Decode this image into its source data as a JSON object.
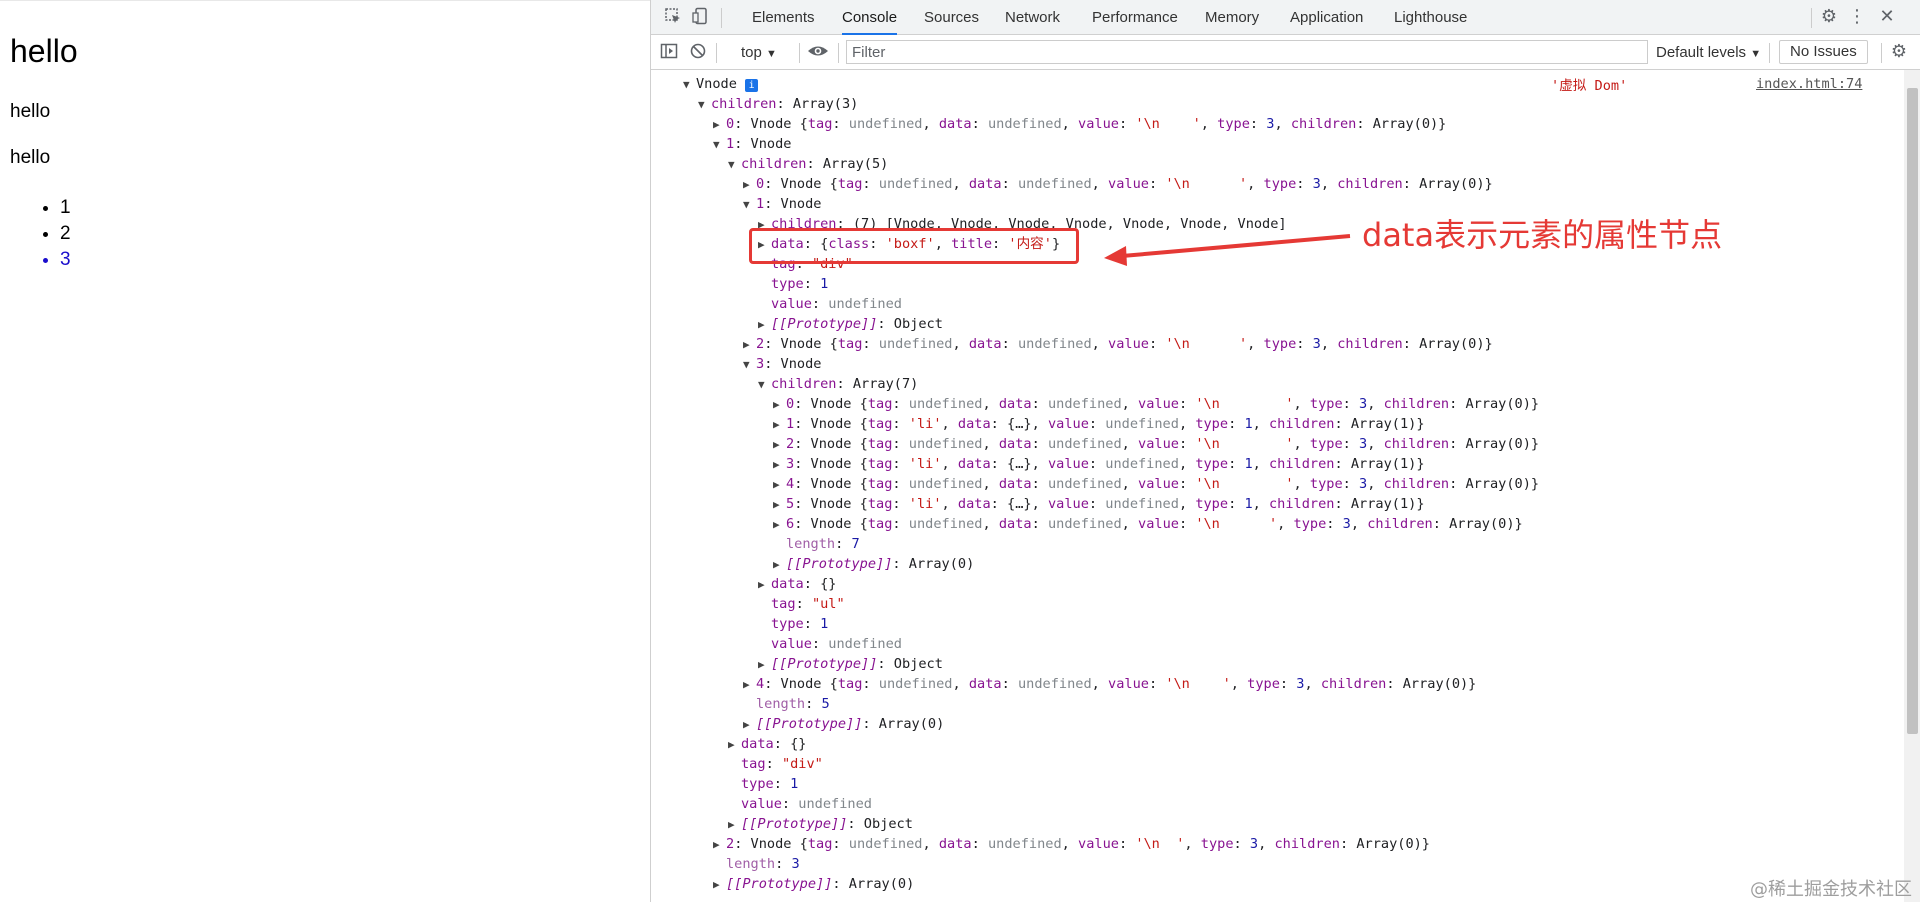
{
  "page": {
    "heading": "hello",
    "para1": "hello",
    "para2": "hello",
    "list": [
      "1",
      "2",
      "3"
    ]
  },
  "devtools": {
    "tabs": [
      "Elements",
      "Console",
      "Sources",
      "Network",
      "Performance",
      "Memory",
      "Application",
      "Lighthouse"
    ],
    "active_tab": "Console",
    "context": "top",
    "filter_placeholder": "Filter",
    "levels": "Default levels",
    "issues": "No Issues",
    "icons": [
      "inspect-icon",
      "device-icon",
      "settings-icon",
      "more-icon",
      "close-icon",
      "sidebar-icon",
      "clear-icon",
      "eye-icon"
    ]
  },
  "console": {
    "message_label": "'虚拟 Dom'",
    "source_link": "index.html:74",
    "lines": [
      {
        "i": 0,
        "t": "d",
        "h": "<span>Vnode</span> <span style=\"display:inline-block;width:13px;height:13px;background:#1a73e8;color:#fff;font-size:10px;line-height:13px;text-align:center;border-radius:2px;\">i</span>"
      },
      {
        "i": 1,
        "t": "d",
        "h": "<span class=\"k\">children</span>: Array(3)"
      },
      {
        "i": 2,
        "t": "r",
        "h": "<span class=\"k\">0</span>: Vnode {<span class=\"k\">tag</span>: <span class=\"u\">undefined</span>, <span class=\"k\">data</span>: <span class=\"u\">undefined</span>, <span class=\"k\">value</span>: <span class=\"s\">'\\n    '</span>, <span class=\"k\">type</span>: <span class=\"n\">3</span>, <span class=\"k\">children</span>: Array(0)}"
      },
      {
        "i": 2,
        "t": "d",
        "h": "<span class=\"k\">1</span>: Vnode"
      },
      {
        "i": 3,
        "t": "d",
        "h": "<span class=\"k\">children</span>: Array(5)"
      },
      {
        "i": 4,
        "t": "r",
        "h": "<span class=\"k\">0</span>: Vnode {<span class=\"k\">tag</span>: <span class=\"u\">undefined</span>, <span class=\"k\">data</span>: <span class=\"u\">undefined</span>, <span class=\"k\">value</span>: <span class=\"s\">'\\n      '</span>, <span class=\"k\">type</span>: <span class=\"n\">3</span>, <span class=\"k\">children</span>: Array(0)}"
      },
      {
        "i": 4,
        "t": "d",
        "h": "<span class=\"k\">1</span>: Vnode"
      },
      {
        "i": 5,
        "t": "r",
        "h": "<span class=\"k\">children</span>: (7) [Vnode, Vnode, Vnode, Vnode, Vnode, Vnode, Vnode]"
      },
      {
        "i": 5,
        "t": "r",
        "h": "<span class=\"k\">data</span>: {<span class=\"k\">class</span>: <span class=\"s\">'boxf'</span>, <span class=\"k\">title</span>: <span class=\"s\">'内容'</span>}"
      },
      {
        "i": 5,
        "t": "n",
        "h": "<span class=\"k\">tag</span>: <span class=\"s\">\"div\"</span>"
      },
      {
        "i": 5,
        "t": "n",
        "h": "<span class=\"k\">type</span>: <span class=\"n\">1</span>"
      },
      {
        "i": 5,
        "t": "n",
        "h": "<span class=\"k\">value</span>: <span class=\"u\">undefined</span>"
      },
      {
        "i": 5,
        "t": "r",
        "h": "<span class=\"k it\">[[Prototype]]</span>: Object"
      },
      {
        "i": 4,
        "t": "r",
        "h": "<span class=\"k\">2</span>: Vnode {<span class=\"k\">tag</span>: <span class=\"u\">undefined</span>, <span class=\"k\">data</span>: <span class=\"u\">undefined</span>, <span class=\"k\">value</span>: <span class=\"s\">'\\n      '</span>, <span class=\"k\">type</span>: <span class=\"n\">3</span>, <span class=\"k\">children</span>: Array(0)}"
      },
      {
        "i": 4,
        "t": "d",
        "h": "<span class=\"k\">3</span>: Vnode"
      },
      {
        "i": 5,
        "t": "d",
        "h": "<span class=\"k\">children</span>: Array(7)"
      },
      {
        "i": 6,
        "t": "r",
        "h": "<span class=\"k\">0</span>: Vnode {<span class=\"k\">tag</span>: <span class=\"u\">undefined</span>, <span class=\"k\">data</span>: <span class=\"u\">undefined</span>, <span class=\"k\">value</span>: <span class=\"s\">'\\n        '</span>, <span class=\"k\">type</span>: <span class=\"n\">3</span>, <span class=\"k\">children</span>: Array(0)}"
      },
      {
        "i": 6,
        "t": "r",
        "h": "<span class=\"k\">1</span>: Vnode {<span class=\"k\">tag</span>: <span class=\"s\">'li'</span>, <span class=\"k\">data</span>: {…}, <span class=\"k\">value</span>: <span class=\"u\">undefined</span>, <span class=\"k\">type</span>: <span class=\"n\">1</span>, <span class=\"k\">children</span>: Array(1)}"
      },
      {
        "i": 6,
        "t": "r",
        "h": "<span class=\"k\">2</span>: Vnode {<span class=\"k\">tag</span>: <span class=\"u\">undefined</span>, <span class=\"k\">data</span>: <span class=\"u\">undefined</span>, <span class=\"k\">value</span>: <span class=\"s\">'\\n        '</span>, <span class=\"k\">type</span>: <span class=\"n\">3</span>, <span class=\"k\">children</span>: Array(0)}"
      },
      {
        "i": 6,
        "t": "r",
        "h": "<span class=\"k\">3</span>: Vnode {<span class=\"k\">tag</span>: <span class=\"s\">'li'</span>, <span class=\"k\">data</span>: {…}, <span class=\"k\">value</span>: <span class=\"u\">undefined</span>, <span class=\"k\">type</span>: <span class=\"n\">1</span>, <span class=\"k\">children</span>: Array(1)}"
      },
      {
        "i": 6,
        "t": "r",
        "h": "<span class=\"k\">4</span>: Vnode {<span class=\"k\">tag</span>: <span class=\"u\">undefined</span>, <span class=\"k\">data</span>: <span class=\"u\">undefined</span>, <span class=\"k\">value</span>: <span class=\"s\">'\\n        '</span>, <span class=\"k\">type</span>: <span class=\"n\">3</span>, <span class=\"k\">children</span>: Array(0)}"
      },
      {
        "i": 6,
        "t": "r",
        "h": "<span class=\"k\">5</span>: Vnode {<span class=\"k\">tag</span>: <span class=\"s\">'li'</span>, <span class=\"k\">data</span>: {…}, <span class=\"k\">value</span>: <span class=\"u\">undefined</span>, <span class=\"k\">type</span>: <span class=\"n\">1</span>, <span class=\"k\">children</span>: Array(1)}"
      },
      {
        "i": 6,
        "t": "r",
        "h": "<span class=\"k\">6</span>: Vnode {<span class=\"k\">tag</span>: <span class=\"u\">undefined</span>, <span class=\"k\">data</span>: <span class=\"u\">undefined</span>, <span class=\"k\">value</span>: <span class=\"s\">'\\n      '</span>, <span class=\"k\">type</span>: <span class=\"n\">3</span>, <span class=\"k\">children</span>: Array(0)}"
      },
      {
        "i": 6,
        "t": "n",
        "h": "<span class=\"kd\">length</span>: <span class=\"n\">7</span>"
      },
      {
        "i": 6,
        "t": "r",
        "h": "<span class=\"k it\">[[Prototype]]</span>: Array(0)"
      },
      {
        "i": 5,
        "t": "r",
        "h": "<span class=\"k\">data</span>: {}"
      },
      {
        "i": 5,
        "t": "n",
        "h": "<span class=\"k\">tag</span>: <span class=\"s\">\"ul\"</span>"
      },
      {
        "i": 5,
        "t": "n",
        "h": "<span class=\"k\">type</span>: <span class=\"n\">1</span>"
      },
      {
        "i": 5,
        "t": "n",
        "h": "<span class=\"k\">value</span>: <span class=\"u\">undefined</span>"
      },
      {
        "i": 5,
        "t": "r",
        "h": "<span class=\"k it\">[[Prototype]]</span>: Object"
      },
      {
        "i": 4,
        "t": "r",
        "h": "<span class=\"k\">4</span>: Vnode {<span class=\"k\">tag</span>: <span class=\"u\">undefined</span>, <span class=\"k\">data</span>: <span class=\"u\">undefined</span>, <span class=\"k\">value</span>: <span class=\"s\">'\\n    '</span>, <span class=\"k\">type</span>: <span class=\"n\">3</span>, <span class=\"k\">children</span>: Array(0)}"
      },
      {
        "i": 4,
        "t": "n",
        "h": "<span class=\"kd\">length</span>: <span class=\"n\">5</span>"
      },
      {
        "i": 4,
        "t": "r",
        "h": "<span class=\"k it\">[[Prototype]]</span>: Array(0)"
      },
      {
        "i": 3,
        "t": "r",
        "h": "<span class=\"k\">data</span>: {}"
      },
      {
        "i": 3,
        "t": "n",
        "h": "<span class=\"k\">tag</span>: <span class=\"s\">\"div\"</span>"
      },
      {
        "i": 3,
        "t": "n",
        "h": "<span class=\"k\">type</span>: <span class=\"n\">1</span>"
      },
      {
        "i": 3,
        "t": "n",
        "h": "<span class=\"k\">value</span>: <span class=\"u\">undefined</span>"
      },
      {
        "i": 3,
        "t": "r",
        "h": "<span class=\"k it\">[[Prototype]]</span>: Object"
      },
      {
        "i": 2,
        "t": "r",
        "h": "<span class=\"k\">2</span>: Vnode {<span class=\"k\">tag</span>: <span class=\"u\">undefined</span>, <span class=\"k\">data</span>: <span class=\"u\">undefined</span>, <span class=\"k\">value</span>: <span class=\"s\">'\\n  '</span>, <span class=\"k\">type</span>: <span class=\"n\">3</span>, <span class=\"k\">children</span>: Array(0)}"
      },
      {
        "i": 2,
        "t": "n",
        "h": "<span class=\"kd\">length</span>: <span class=\"n\">3</span>"
      },
      {
        "i": 2,
        "t": "r",
        "h": "<span class=\"k it\">[[Prototype]]</span>: Array(0)"
      }
    ]
  },
  "annotation": {
    "text": "data表示元素的属性节点",
    "color": "#e53935"
  },
  "watermark": "@稀土掘金技术社区"
}
